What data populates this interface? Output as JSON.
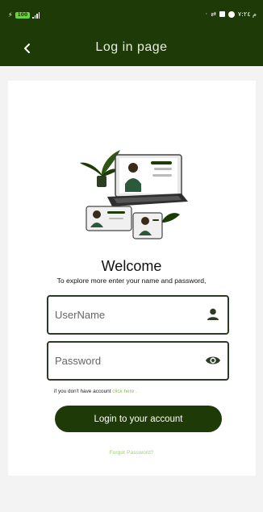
{
  "status_bar": {
    "battery": "100",
    "time": "م ٧:٢٤"
  },
  "app_bar": {
    "title": "Log in page"
  },
  "welcome": {
    "title": "Welcome",
    "subtitle": "To explore more enter your name and password,"
  },
  "form": {
    "username_placeholder": "UserName",
    "password_placeholder": "Password"
  },
  "register": {
    "prompt": "if you don't have account ",
    "link": "click here ."
  },
  "login_button": "Login to your account",
  "forgot_password": "Forgot Password?",
  "colors": {
    "primary": "#1e3a06",
    "accent_link": "#8bbf59"
  }
}
